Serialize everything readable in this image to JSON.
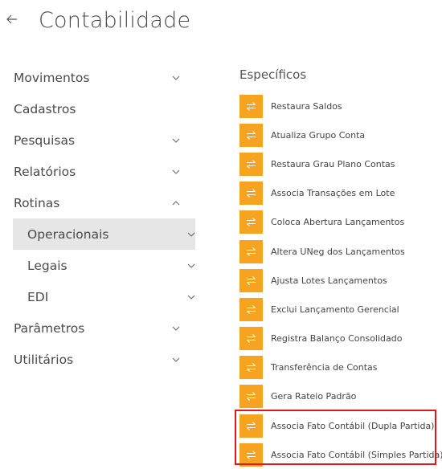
{
  "header": {
    "back_icon": "arrow-left-icon",
    "title": "Contabilidade"
  },
  "menu": {
    "items": [
      {
        "label": "Movimentos",
        "icon": "chevron-down-icon"
      },
      {
        "label": "Cadastros"
      },
      {
        "label": "Pesquisas",
        "icon": "chevron-down-icon"
      },
      {
        "label": "Relatórios",
        "icon": "chevron-down-icon"
      },
      {
        "label": "Rotinas",
        "icon": "chevron-up-icon",
        "expanded": true
      }
    ],
    "rotinas_subitems": [
      {
        "label": "Operacionais",
        "icon": "chevron-down-icon",
        "active": true
      },
      {
        "label": "Legais",
        "icon": "chevron-down-icon"
      },
      {
        "label": "EDI",
        "icon": "chevron-down-icon"
      }
    ],
    "after_items": [
      {
        "label": "Parâmetros",
        "icon": "chevron-down-icon"
      },
      {
        "label": "Utilitários",
        "icon": "chevron-down-icon"
      }
    ]
  },
  "specific": {
    "title": "Específicos",
    "icon": "swap-arrows-icon",
    "accent_color": "#f6a31f",
    "highlight_color": "#e11818",
    "actions": [
      {
        "label": "Restaura Saldos"
      },
      {
        "label": "Atualiza Grupo Conta"
      },
      {
        "label": "Restaura Grau Plano Contas"
      },
      {
        "label": "Associa Transações em Lote"
      },
      {
        "label": "Coloca Abertura Lançamentos"
      },
      {
        "label": "Altera UNeg dos Lançamentos"
      },
      {
        "label": "Ajusta Lotes Lançamentos"
      },
      {
        "label": "Exclui Lançamento Gerencial"
      },
      {
        "label": "Registra Balanço Consolidado"
      },
      {
        "label": "Transferência de Contas"
      },
      {
        "label": "Gera Rateio Padrão"
      },
      {
        "label": "Associa Fato Contábil (Dupla Partida)",
        "highlighted": true
      },
      {
        "label": "Associa Fato Contábil (Simples Partida)",
        "highlighted": true
      }
    ]
  }
}
